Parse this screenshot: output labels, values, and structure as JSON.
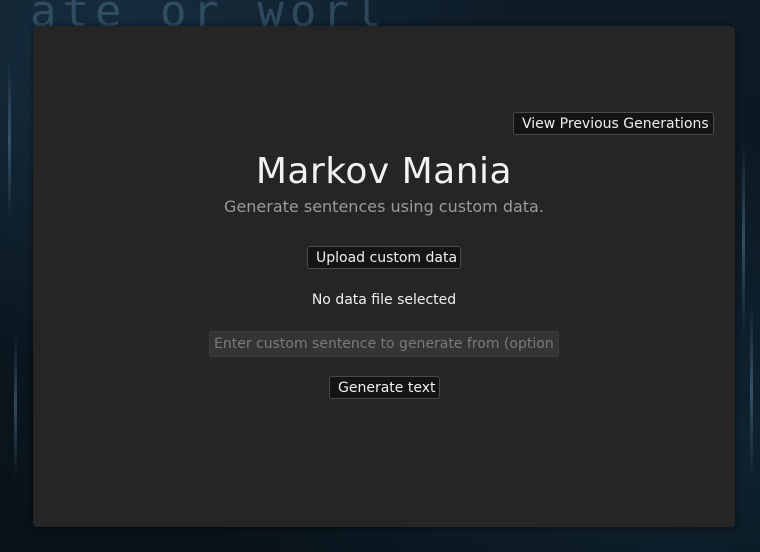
{
  "background": {
    "text": "ate or worl"
  },
  "header": {
    "history_button_label": "View Previous Generations"
  },
  "main": {
    "title": "Markov Mania",
    "subtitle": "Generate sentences using custom data.",
    "upload_button_label": "Upload custom data",
    "file_status": "No data file selected",
    "sentence_input": {
      "value": "",
      "placeholder": "Enter custom sentence to generate from (optional)"
    },
    "generate_button_label": "Generate text"
  },
  "colors": {
    "panel": "#252526",
    "button_bg": "#141414",
    "text": "#f2f2f2",
    "muted_text": "#9a9a9a"
  }
}
